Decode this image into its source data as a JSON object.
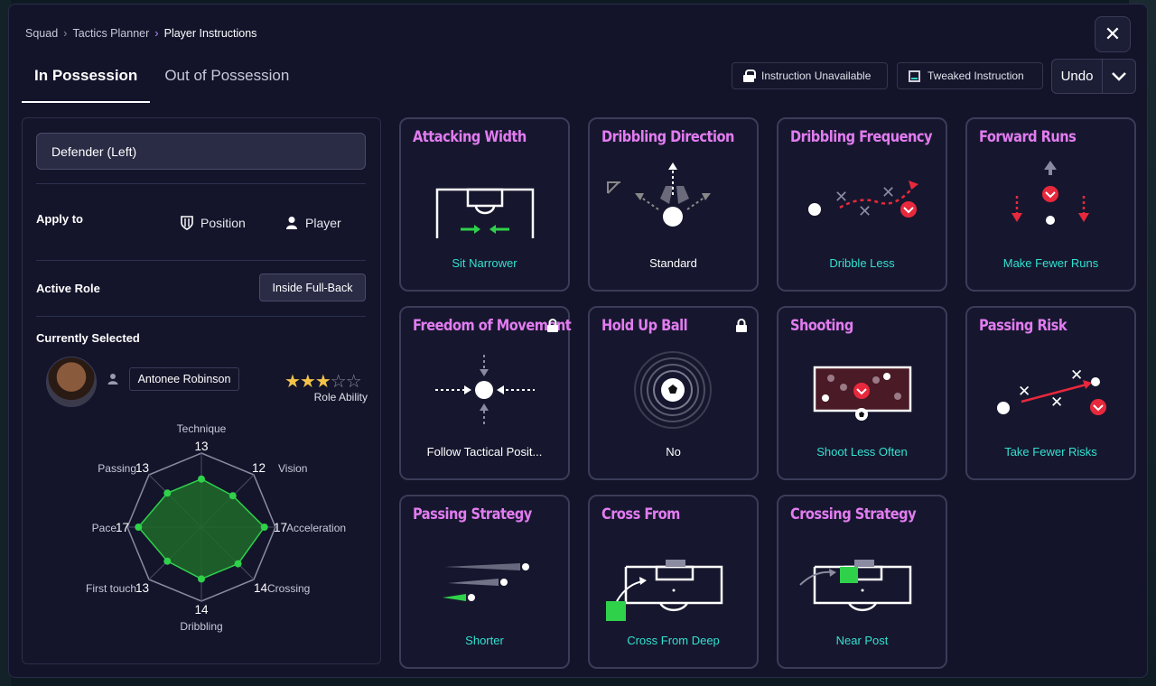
{
  "breadcrumb": [
    "Squad",
    "Tactics Planner",
    "Player Instructions"
  ],
  "close_label": "✕",
  "tabs": [
    "In Possession",
    "Out of Possession"
  ],
  "legend": {
    "unavailable": "Instruction Unavailable",
    "tweaked": "Tweaked Instruction"
  },
  "undo_label": "Undo",
  "left_panel": {
    "role_select_value": "Defender (Left)",
    "apply_to_label": "Apply to",
    "apply_position": "Position",
    "apply_player": "Player",
    "active_role_label": "Active Role",
    "active_role_value": "Inside Full-Back",
    "currently_selected_label": "Currently Selected",
    "player_name": "Antonee Robinson",
    "role_ability_label": "Role Ability",
    "role_ability_stars": 3,
    "role_ability_max": 5,
    "attributes": [
      {
        "name": "Technique",
        "value": "13"
      },
      {
        "name": "Vision",
        "value": "12"
      },
      {
        "name": "Acceleration",
        "value": "17"
      },
      {
        "name": "Crossing",
        "value": "14"
      },
      {
        "name": "Dribbling",
        "value": "14"
      },
      {
        "name": "First touch",
        "value": "13"
      },
      {
        "name": "Pace",
        "value": "17"
      },
      {
        "name": "Passing",
        "value": "13"
      }
    ]
  },
  "instructions": [
    {
      "title": "Attacking Width",
      "value": "Sit Narrower",
      "tweaked": true,
      "locked": false,
      "icon": "pitch-width-icon"
    },
    {
      "title": "Dribbling Direction",
      "value": "Standard",
      "tweaked": false,
      "locked": false,
      "icon": "dribble-direction-icon"
    },
    {
      "title": "Dribbling Frequency",
      "value": "Dribble Less",
      "tweaked": true,
      "locked": false,
      "icon": "dribble-frequency-icon"
    },
    {
      "title": "Forward Runs",
      "value": "Make Fewer Runs",
      "tweaked": true,
      "locked": false,
      "icon": "forward-runs-icon"
    },
    {
      "title": "Freedom of Movement",
      "value": "Follow Tactical Posit...",
      "tweaked": false,
      "locked": true,
      "icon": "movement-icon"
    },
    {
      "title": "Hold Up Ball",
      "value": "No",
      "tweaked": false,
      "locked": true,
      "icon": "hold-ball-icon"
    },
    {
      "title": "Shooting",
      "value": "Shoot Less Often",
      "tweaked": true,
      "locked": false,
      "icon": "shooting-icon"
    },
    {
      "title": "Passing Risk",
      "value": "Take Fewer Risks",
      "tweaked": true,
      "locked": false,
      "icon": "passing-risk-icon"
    },
    {
      "title": "Passing Strategy",
      "value": "Shorter",
      "tweaked": true,
      "locked": false,
      "icon": "passing-strategy-icon"
    },
    {
      "title": "Cross From",
      "value": "Cross From Deep",
      "tweaked": true,
      "locked": false,
      "icon": "cross-from-icon"
    },
    {
      "title": "Crossing Strategy",
      "value": "Near Post",
      "tweaked": true,
      "locked": false,
      "icon": "crossing-strategy-icon"
    }
  ],
  "colors": {
    "title": "#e27cf0",
    "tweaked_value": "#33e0d0",
    "radar_fill": "#1f6a2a",
    "radar_dot": "#2fd14a",
    "decrease_badge": "#e8283c",
    "star": "#f3c34a"
  }
}
